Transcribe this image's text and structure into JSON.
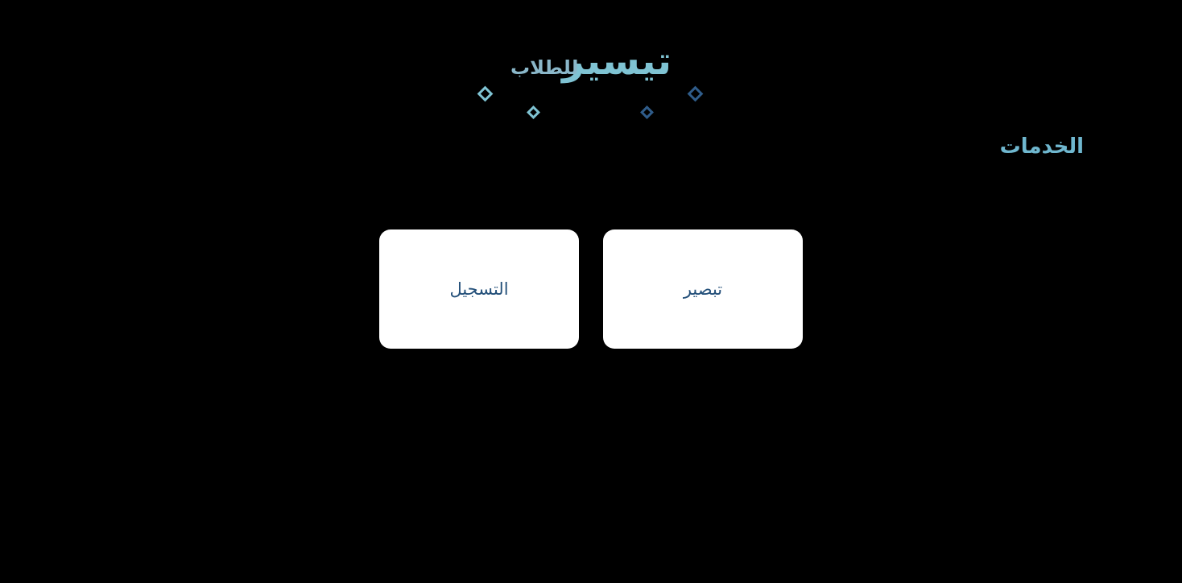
{
  "logo": {
    "main_text": "تيسير",
    "sub_text": "للطلاب",
    "colors": {
      "light": "#7fc3d3",
      "dark": "#2f5c8a"
    }
  },
  "services": {
    "title": "الخدمات",
    "items": [
      {
        "label": "تبصير"
      },
      {
        "label": "التسجيل"
      }
    ]
  },
  "colors": {
    "background": "#000000",
    "card_background": "#ffffff",
    "card_text": "#24507a",
    "title_text": "#6fb7cf"
  }
}
